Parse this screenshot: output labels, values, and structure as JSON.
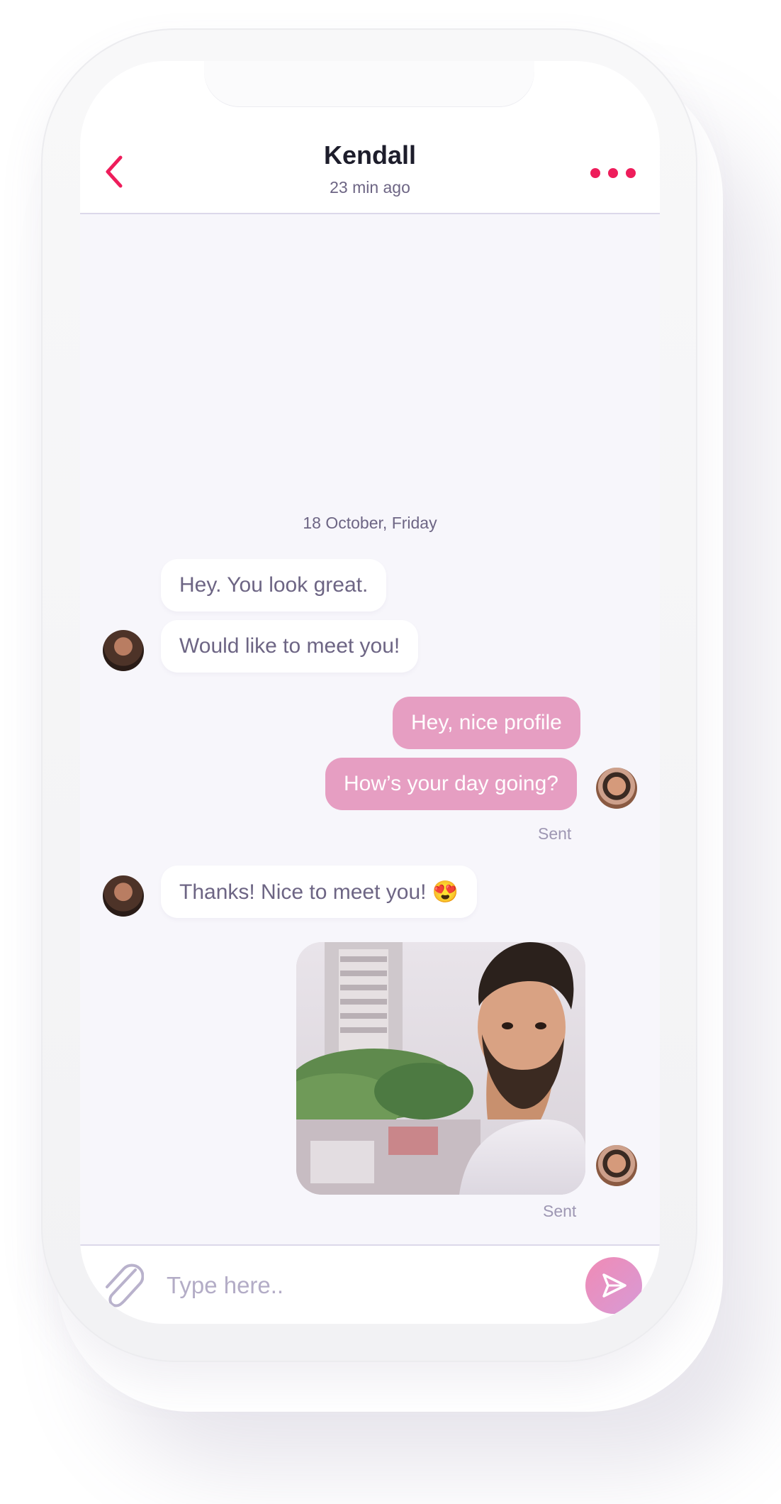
{
  "header": {
    "contact_name": "Kendall",
    "last_seen": "23 min ago"
  },
  "icons": {
    "back": "chevron-left-icon",
    "more": "more-horizontal-icon",
    "attach": "paperclip-icon",
    "send": "send-icon"
  },
  "colors": {
    "accent": "#ee1d5b",
    "outgoing_bubble": "#e69ec2",
    "incoming_bubble": "#ffffff",
    "chat_background": "#f7f6fb",
    "muted_text": "#6d6584"
  },
  "chat": {
    "date_separator": "18 October, Friday",
    "messages": [
      {
        "direction": "incoming",
        "text": "Hey. You look great."
      },
      {
        "direction": "incoming",
        "text": "Would like to meet you!"
      },
      {
        "direction": "outgoing",
        "text": "Hey, nice profile"
      },
      {
        "direction": "outgoing",
        "text": "How’s your day going?",
        "status": "Sent"
      },
      {
        "direction": "incoming",
        "text": "Thanks! Nice to meet you! 😍"
      },
      {
        "direction": "outgoing",
        "type": "photo",
        "status": "Sent"
      }
    ]
  },
  "composer": {
    "placeholder": "Type here..",
    "value": ""
  }
}
